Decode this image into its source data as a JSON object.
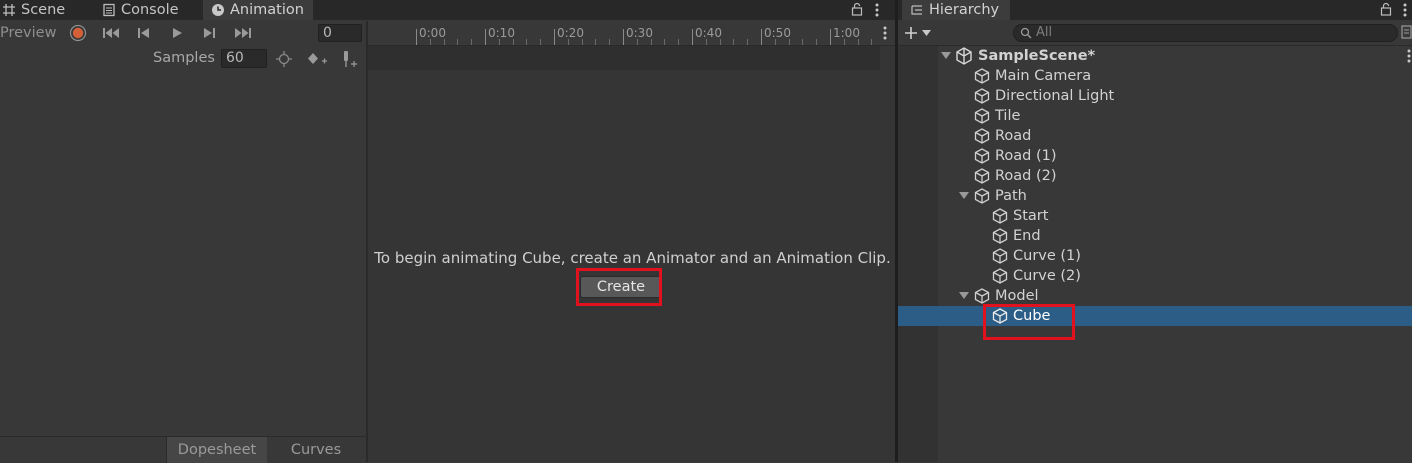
{
  "tabs": {
    "scene": "Scene",
    "console": "Console",
    "animation": "Animation"
  },
  "anim_toolbar": {
    "preview": "Preview",
    "frame": "0",
    "samples_label": "Samples",
    "samples_value": "60"
  },
  "timeline": {
    "ticks": [
      "0:00",
      "0:10",
      "0:20",
      "0:30",
      "0:40",
      "0:50",
      "1:00"
    ]
  },
  "empty_state": {
    "message": "To begin animating Cube, create an Animator and an Animation Clip.",
    "create": "Create"
  },
  "bottom_tabs": {
    "dopesheet": "Dopesheet",
    "curves": "Curves"
  },
  "hierarchy": {
    "title": "Hierarchy",
    "search_placeholder": "All",
    "scene": "SampleScene*",
    "items": [
      {
        "label": "Main Camera"
      },
      {
        "label": "Directional Light"
      },
      {
        "label": "Tile"
      },
      {
        "label": "Road"
      },
      {
        "label": "Road (1)"
      },
      {
        "label": "Road (2)"
      },
      {
        "label": "Path"
      },
      {
        "label": "Start"
      },
      {
        "label": "End"
      },
      {
        "label": "Curve (1)"
      },
      {
        "label": "Curve (2)"
      },
      {
        "label": "Model"
      },
      {
        "label": "Cube"
      }
    ]
  },
  "colors": {
    "highlight": "#e1111d",
    "selection": "#2c5d87",
    "record": "#d4603a"
  }
}
